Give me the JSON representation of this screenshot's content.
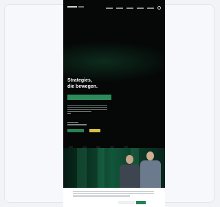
{
  "nav": {
    "links": [
      "",
      "",
      "",
      "",
      ""
    ]
  },
  "hero": {
    "headline_line1": "Strategies,",
    "headline_line2": "die bewegen."
  },
  "colors": {
    "background": "#050807",
    "accent_green": "#2a7f54",
    "accent_yellow": "#d8bc46",
    "page_bg": "#f1f3f7"
  },
  "icons": [
    "search-icon"
  ]
}
